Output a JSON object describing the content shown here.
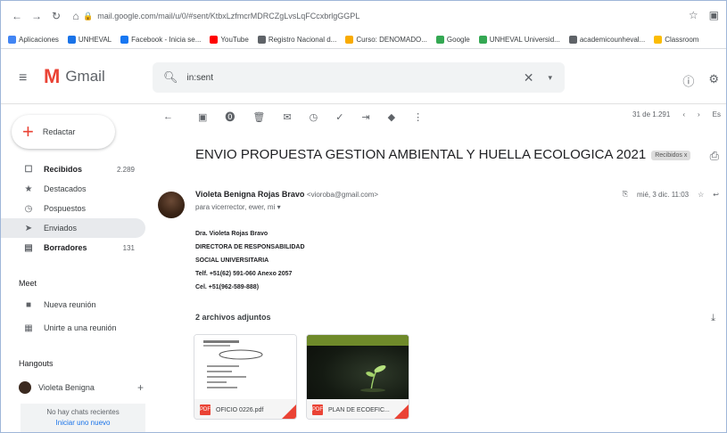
{
  "browser": {
    "url": "mail.google.com/mail/u/0/#sent/KtbxLzfmcrMDRCZgLvsLqFCcxbrlgGGPL",
    "bookmarks": [
      {
        "label": "Aplicaciones",
        "color": "#4285f4"
      },
      {
        "label": "UNHEVAL",
        "color": "#1a73e8"
      },
      {
        "label": "Facebook - Inicia se...",
        "color": "#1877f2"
      },
      {
        "label": "YouTube",
        "color": "#ff0000"
      },
      {
        "label": "Registro Nacional d...",
        "color": "#5f6368"
      },
      {
        "label": "Curso: DENOMADO...",
        "color": "#f9ab00"
      },
      {
        "label": "Google",
        "color": "#34a853"
      },
      {
        "label": "UNHEVAL Universid...",
        "color": "#34a853"
      },
      {
        "label": "academicounheval...",
        "color": "#5f6368"
      },
      {
        "label": "Classroom",
        "color": "#fbbc04"
      }
    ]
  },
  "gmail": {
    "logo_text": "Gmail",
    "search_value": "in:sent",
    "compose_label": "Redactar",
    "nav": [
      {
        "icon": "inbox-icon",
        "glyph": "☐",
        "label": "Recibidos",
        "count": "2.289",
        "bold": true,
        "active": false
      },
      {
        "icon": "star-icon",
        "glyph": "★",
        "label": "Destacados",
        "count": "",
        "bold": false,
        "active": false
      },
      {
        "icon": "snooze-icon",
        "glyph": "◷",
        "label": "Pospuestos",
        "count": "",
        "bold": false,
        "active": false
      },
      {
        "icon": "send-icon",
        "glyph": "➤",
        "label": "Enviados",
        "count": "",
        "bold": false,
        "active": true
      },
      {
        "icon": "draft-icon",
        "glyph": "▤",
        "label": "Borradores",
        "count": "131",
        "bold": true,
        "active": false
      }
    ],
    "meet": {
      "title": "Meet",
      "items": [
        {
          "icon": "video-icon",
          "glyph": "■",
          "label": "Nueva reunión"
        },
        {
          "icon": "keyboard-icon",
          "glyph": "▦",
          "label": "Unirte a una reunión"
        }
      ]
    },
    "hangouts": {
      "title": "Hangouts",
      "user": "Violeta Benigna",
      "empty_text": "No hay chats recientes",
      "empty_link": "Iniciar uno nuevo"
    }
  },
  "message": {
    "pager": "31 de 1.291",
    "subject": "ENVIO PROPUESTA GESTION AMBIENTAL Y HUELLA ECOLOGICA 2021",
    "label_chip": "Recibidos x",
    "sender_name": "Violeta Benigna Rojas Bravo",
    "sender_email": "<vioroba@gmail.com>",
    "to_line": "para vicerrector, ewer, mi ▾",
    "date": "mié, 3 dic. 11:03",
    "signature": [
      "Dra. Violeta Rojas Bravo",
      "DIRECTORA DE RESPONSABILIDAD",
      "SOCIAL UNIVERSITARIA",
      "Telf. +51(62) 591-060 Anexo 2057",
      "Cel. +51(962-589-888)"
    ],
    "attachments_title": "2 archivos adjuntos",
    "attachments": [
      {
        "name": "OFICIO 0226.pdf",
        "type": "PDF"
      },
      {
        "name": "PLAN DE ECOEFIC...",
        "type": "PDF"
      }
    ]
  }
}
